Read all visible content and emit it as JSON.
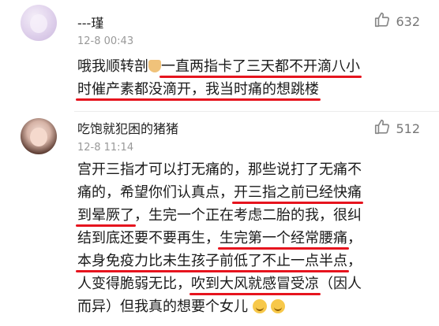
{
  "comments": [
    {
      "username": "---瑾",
      "time": "12-8 00:43",
      "likes": "632",
      "lines": [
        [
          "哦我顺转剖",
          "[hands]",
          "一直两指卡了三天都不开滴八小"
        ],
        [
          "时催产素都没滴开，我当时痛的想跳楼"
        ]
      ]
    },
    {
      "username": "吃饱就犯困的猪猪",
      "time": "12-8 11:14",
      "likes": "512",
      "lines": [
        [
          "宫开三指才可以打无痛的，那些说打了无痛不"
        ],
        [
          "痛的，希望你们认真点，",
          "开三指之前已经快痛"
        ],
        [
          "到晕厥了",
          "，生完一个正在考虑二胎的我，很纠"
        ],
        [
          "结到底还要不要再生，",
          "生完第一个经常腰痛",
          "，"
        ],
        [
          "本身免疫力比未生孩子前低了不止一点半点",
          "，"
        ],
        [
          "人变得脆弱无比，",
          "吹到大风就感冒受凉",
          "（因人"
        ],
        [
          "而异）但我真的想要个女儿",
          "[emoji]",
          "[emoji]"
        ]
      ]
    }
  ]
}
